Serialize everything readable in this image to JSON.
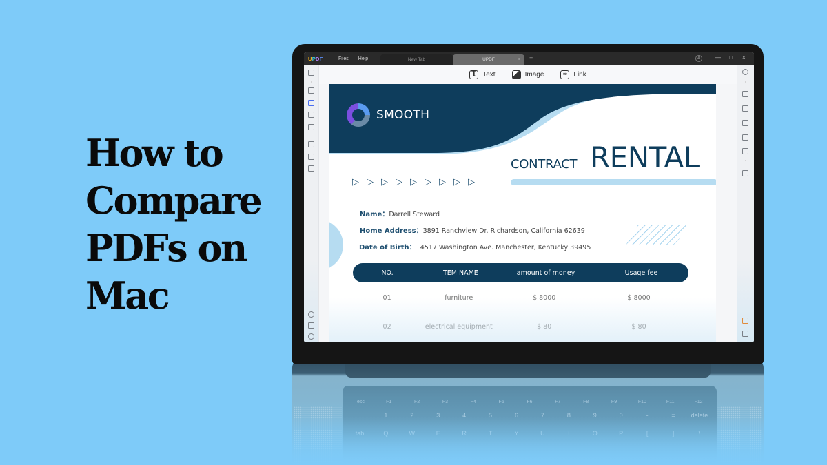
{
  "headline": {
    "lines": [
      "How to",
      "Compare",
      "PDFs on",
      "Mac"
    ]
  },
  "app": {
    "logo": {
      "u": "U",
      "p": "P",
      "d": "D",
      "f": "F"
    },
    "menu": [
      "Files",
      "Help"
    ],
    "tabs": [
      {
        "label": "New Tab",
        "active": false
      },
      {
        "label": "UPDF",
        "active": true,
        "close": "×"
      }
    ],
    "new_tab": "+",
    "window_controls": {
      "account": "A",
      "minimize": "—",
      "maximize": "□",
      "close": "×"
    },
    "edit_toolbar": [
      {
        "icon": "text-icon",
        "glyph": "T",
        "label": "Text"
      },
      {
        "icon": "image-icon",
        "glyph": "",
        "label": "Image"
      },
      {
        "icon": "link-icon",
        "glyph": "∞",
        "label": "Link"
      }
    ]
  },
  "document": {
    "brand": "SMOOTH",
    "title_small": "CONTRACT",
    "title_large": "RENTAL",
    "arrow_glyph": "▷",
    "arrow_count": 9,
    "fields": [
      {
        "label": "Name：",
        "value": "Darrell Steward"
      },
      {
        "label": "Home Address：",
        "value": "3891 Ranchview Dr. Richardson, California 62639"
      },
      {
        "label": "Date of Birth：",
        "value": "4517 Washington Ave. Manchester, Kentucky 39495"
      }
    ],
    "table": {
      "headers": [
        "NO.",
        "ITEM NAME",
        "amount of money",
        "Usage fee"
      ],
      "rows": [
        [
          "01",
          "furniture",
          "$ 8000",
          "$ 8000"
        ],
        [
          "02",
          "electrical equipment",
          "$ 80",
          "$ 80"
        ]
      ]
    }
  },
  "keyboard": {
    "fn_row": [
      "esc",
      "F1",
      "F2",
      "F3",
      "F4",
      "F5",
      "F6",
      "F7",
      "F8",
      "F9",
      "F10",
      "F11",
      "F12"
    ],
    "num_row": [
      "`",
      "1",
      "2",
      "3",
      "4",
      "5",
      "6",
      "7",
      "8",
      "9",
      "0",
      "-",
      "=",
      "delete"
    ],
    "q_row": [
      "tab",
      "Q",
      "W",
      "E",
      "R",
      "T",
      "Y",
      "U",
      "I",
      "O",
      "P",
      "[",
      "]",
      "\\"
    ]
  },
  "colors": {
    "background": "#7ecbf9",
    "doc_navy": "#0e3d5c",
    "doc_light_blue": "#b6dcf1",
    "accent_active": "#4a6ef0"
  }
}
